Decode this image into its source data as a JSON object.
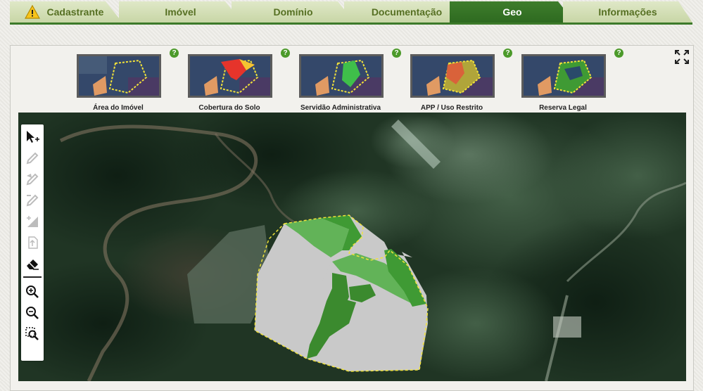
{
  "tabs": [
    {
      "label": "Cadastrante",
      "icon": "warning-icon"
    },
    {
      "label": "Imóvel"
    },
    {
      "label": "Domínio"
    },
    {
      "label": "Documentação"
    },
    {
      "label": "Geo",
      "active": true
    },
    {
      "label": "Informações"
    }
  ],
  "layers": [
    {
      "label": "Área do Imóvel",
      "help": "?"
    },
    {
      "label": "Cobertura do Solo",
      "help": "?"
    },
    {
      "label": "Servidão Administrativa",
      "help": "?"
    },
    {
      "label": "APP / Uso Restrito",
      "help": "?"
    },
    {
      "label": "Reserva Legal",
      "help": "?"
    }
  ],
  "map_tools": [
    "select-pointer-icon",
    "draw-pencil-icon",
    "draw-polygon-icon",
    "draw-line-icon",
    "measure-area-icon",
    "import-file-icon",
    "eraser-icon",
    "zoom-in-icon",
    "zoom-out-icon",
    "zoom-box-icon"
  ],
  "colors": {
    "tab_inactive": "#d3dfb6",
    "tab_active": "#367424",
    "tab_text": "#567023",
    "accent_green": "#3d7a2a",
    "help_badge": "#4c9a2a",
    "polygon_gray": "#c9c9c9",
    "polygon_green": "#3f9a34",
    "boundary_yellow": "#f1e33b"
  }
}
